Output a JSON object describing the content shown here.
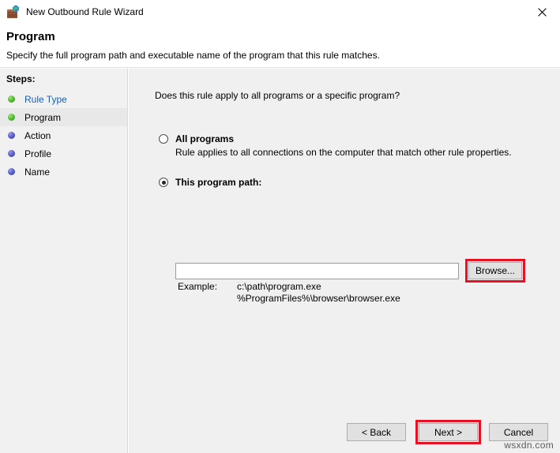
{
  "window": {
    "title": "New Outbound Rule Wizard",
    "icon": "firewall-globe-icon",
    "close_label": "✕"
  },
  "header": {
    "title": "Program",
    "subtitle": "Specify the full program path and executable name of the program that this rule matches."
  },
  "sidebar": {
    "title": "Steps:",
    "items": [
      {
        "label": "Rule Type",
        "state": "done",
        "is_link": true,
        "current": false
      },
      {
        "label": "Program",
        "state": "done",
        "is_link": false,
        "current": true
      },
      {
        "label": "Action",
        "state": "pending",
        "is_link": false,
        "current": false
      },
      {
        "label": "Profile",
        "state": "pending",
        "is_link": false,
        "current": false
      },
      {
        "label": "Name",
        "state": "pending",
        "is_link": false,
        "current": false
      }
    ]
  },
  "main": {
    "question": "Does this rule apply to all programs or a specific program?",
    "options": [
      {
        "label": "All programs",
        "description": "Rule applies to all connections on the computer that match other rule properties.",
        "selected": false
      },
      {
        "label": "This program path:",
        "selected": true
      }
    ],
    "path_field": {
      "value": "",
      "placeholder": ""
    },
    "browse_button": "Browse...",
    "example": {
      "label": "Example:",
      "line1": "c:\\path\\program.exe",
      "line2": "%ProgramFiles%\\browser\\browser.exe"
    }
  },
  "footer": {
    "back_label": "< Back",
    "next_label": "Next >",
    "cancel_label": "Cancel"
  },
  "watermark": "wsxdn.com",
  "colors": {
    "highlight_red": "#e81123",
    "link_blue": "#1a5fb4",
    "panel_gray": "#f0f0f0",
    "sidebar_gray": "#f1f1f1"
  }
}
